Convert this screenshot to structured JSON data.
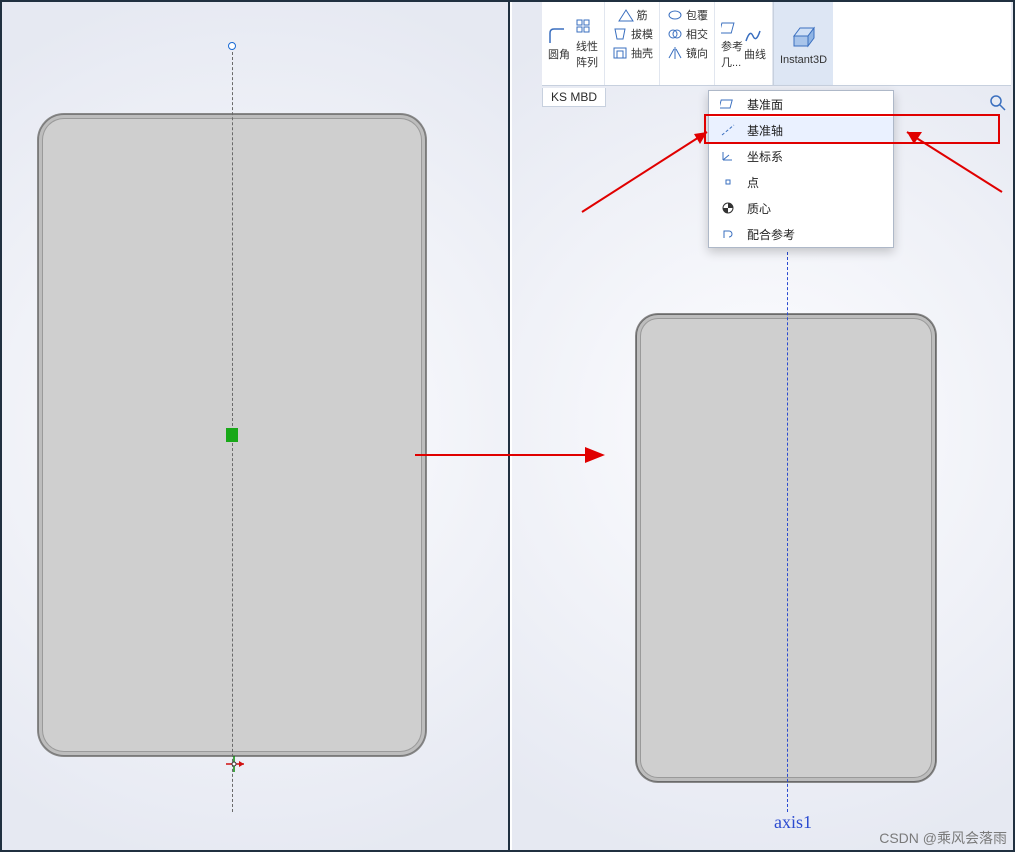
{
  "ribbon": {
    "fillet": "圆角",
    "linear_pattern": "线性\n阵列",
    "rib": "筋",
    "draft": "拔模",
    "shell": "抽壳",
    "wrap": "包覆",
    "intersect": "相交",
    "mirror": "镜向",
    "ref_geom": "参考\n几...",
    "curves": "曲线",
    "instant3d": "Instant3D"
  },
  "tab": {
    "mbd": "KS MBD"
  },
  "menu": {
    "plane": "基准面",
    "axis": "基准轴",
    "coord": "坐标系",
    "point": "点",
    "mass_center": "质心",
    "mate_ref": "配合参考"
  },
  "right_panel": {
    "axis_label": "axis1"
  },
  "watermark": "CSDN @乘风会落雨"
}
